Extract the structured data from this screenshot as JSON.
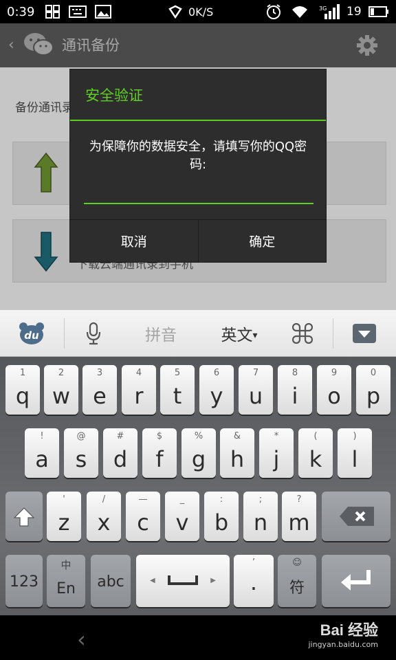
{
  "status_bar": {
    "time": "0:39",
    "net_speed": "0K/S",
    "battery": "19"
  },
  "header": {
    "back_icon": "chevron-left-icon",
    "app_icon": "wechat-icon",
    "title": "通讯备份",
    "settings_icon": "gear-icon"
  },
  "page": {
    "subtitle": "备份通讯录",
    "cards": [
      {
        "icon": "arrow-up-icon",
        "text": ""
      },
      {
        "icon": "arrow-down-icon",
        "text": "下载云端通讯录到手机"
      }
    ]
  },
  "dialog": {
    "title": "安全验证",
    "message": "为保障你的数据安全，请填写你的QQ密码:",
    "input_value": "",
    "cancel_label": "取消",
    "confirm_label": "确定"
  },
  "keyboard_toolbar": {
    "logo": "du",
    "pinyin": "拼音",
    "english": "英文",
    "english_arrow": "▾"
  },
  "keyboard": {
    "row1": [
      {
        "hint": "1",
        "key": "q"
      },
      {
        "hint": "2",
        "key": "w"
      },
      {
        "hint": "3",
        "key": "e"
      },
      {
        "hint": "4",
        "key": "r"
      },
      {
        "hint": "5",
        "key": "t"
      },
      {
        "hint": "6",
        "key": "y"
      },
      {
        "hint": "7",
        "key": "u"
      },
      {
        "hint": "8",
        "key": "i"
      },
      {
        "hint": "9",
        "key": "o"
      },
      {
        "hint": "0",
        "key": "p"
      }
    ],
    "row2": [
      {
        "hint": "!",
        "key": "a"
      },
      {
        "hint": "@",
        "key": "s"
      },
      {
        "hint": "#",
        "key": "d"
      },
      {
        "hint": "$",
        "key": "f"
      },
      {
        "hint": "%",
        "key": "g"
      },
      {
        "hint": "&",
        "key": "h"
      },
      {
        "hint": "*",
        "key": "j"
      },
      {
        "hint": "(",
        "key": "k"
      },
      {
        "hint": ")",
        "key": "l"
      }
    ],
    "row3": [
      {
        "hint": "'",
        "key": "z"
      },
      {
        "hint": "/",
        "key": "x"
      },
      {
        "hint": "—",
        "key": "c"
      },
      {
        "hint": "_",
        "key": "v"
      },
      {
        "hint": ":",
        "key": "b"
      },
      {
        "hint": ";",
        "key": "n"
      },
      {
        "hint": "?",
        "key": "m"
      }
    ],
    "num_label": "123",
    "cn_hint": "中",
    "en_label": "En",
    "abc_label": "abc",
    "punct_hint": "’",
    "punct_key": "·",
    "symbol_hint": "☺",
    "symbol_key": "符"
  },
  "watermark": {
    "text": "Bai 经验",
    "url": "jingyan.baidu.com"
  }
}
